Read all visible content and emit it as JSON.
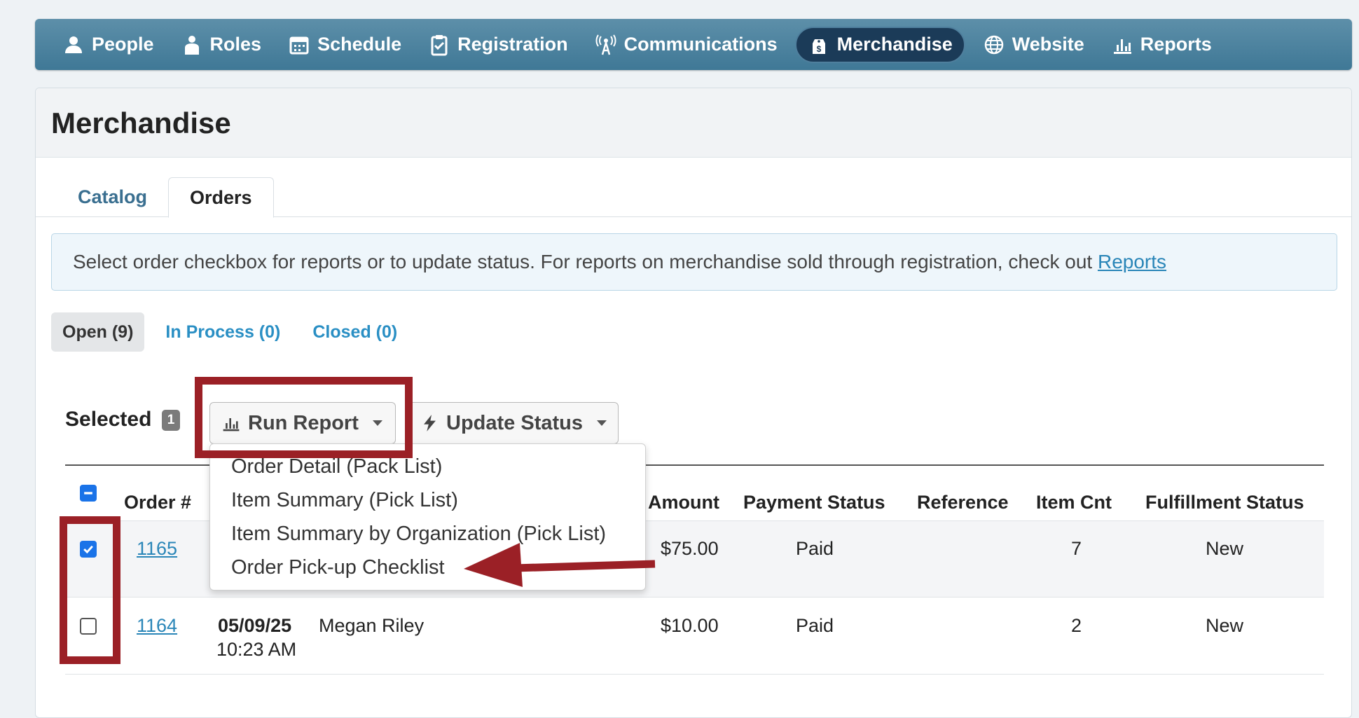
{
  "nav": {
    "items": [
      {
        "label": "People",
        "icon": "person-icon"
      },
      {
        "label": "Roles",
        "icon": "badge-person-icon"
      },
      {
        "label": "Schedule",
        "icon": "calendar-icon"
      },
      {
        "label": "Registration",
        "icon": "clipboard-check-icon"
      },
      {
        "label": "Communications",
        "icon": "broadcast-tower-icon"
      },
      {
        "label": "Merchandise",
        "icon": "price-tag-icon"
      },
      {
        "label": "Website",
        "icon": "globe-icon"
      },
      {
        "label": "Reports",
        "icon": "bar-chart-icon"
      }
    ],
    "active": "Merchandise",
    "colors": {
      "bar": "#4a84a3",
      "active": "#1b3b58"
    }
  },
  "page": {
    "title": "Merchandise",
    "tabs": [
      {
        "label": "Catalog"
      },
      {
        "label": "Orders"
      }
    ],
    "active_tab": "Orders"
  },
  "info": {
    "text": "Select order checkbox for reports or to update status. For reports on merchandise sold through registration, check out ",
    "link": "Reports"
  },
  "filters": [
    {
      "label": "Open (9)"
    },
    {
      "label": "In Process (0)"
    },
    {
      "label": "Closed (0)"
    }
  ],
  "toolbar": {
    "selected_label": "Selected",
    "selected_count": "1",
    "run_report": "Run Report",
    "update_status": "Update Status"
  },
  "report_menu": {
    "items": [
      {
        "label": "Order Detail (Pack List)"
      },
      {
        "label": "Item Summary (Pick List)"
      },
      {
        "label": "Item Summary by Organization (Pick List)"
      },
      {
        "label": "Order Pick-up Checklist"
      }
    ]
  },
  "table": {
    "headers": {
      "order": "Order #",
      "amount": "Amount",
      "payment_status": "Payment Status",
      "reference": "Reference",
      "item_cnt": "Item Cnt",
      "fulfillment_status": "Fulfillment Status"
    },
    "rows": [
      {
        "checked": true,
        "order": "1165",
        "date": "",
        "time": "",
        "name": "",
        "amount": "$75.00",
        "payment_status": "Paid",
        "reference": "",
        "item_cnt": "7",
        "fulfillment_status": "New"
      },
      {
        "checked": false,
        "order": "1164",
        "date": "05/09/25",
        "time": "10:23 AM",
        "name": "Megan Riley",
        "amount": "$10.00",
        "payment_status": "Paid",
        "reference": "",
        "item_cnt": "2",
        "fulfillment_status": "New"
      }
    ]
  },
  "annotation_color": "#9b2026"
}
